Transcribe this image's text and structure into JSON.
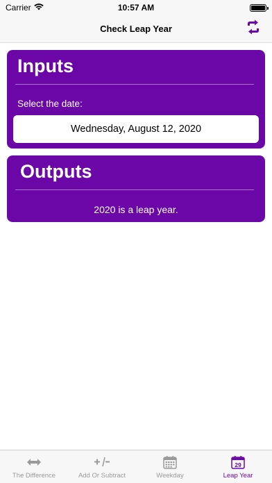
{
  "status": {
    "carrier": "Carrier",
    "time": "10:57 AM"
  },
  "nav": {
    "title": "Check Leap Year",
    "action_icon": "swap-arrows-icon"
  },
  "inputs": {
    "title": "Inputs",
    "label": "Select the date:",
    "date_value": "Wednesday, August 12, 2020"
  },
  "outputs": {
    "title": "Outputs",
    "result": "2020 is a leap year."
  },
  "tabs": [
    {
      "label": "The Difference",
      "icon": "double-arrow-icon",
      "active": false
    },
    {
      "label": "Add Or Subtract",
      "icon": "plus-minus-icon",
      "active": false
    },
    {
      "label": "Weekday",
      "icon": "calendar-grid-icon",
      "active": false
    },
    {
      "label": "Leap Year",
      "icon": "calendar-29-icon",
      "active": true
    }
  ],
  "colors": {
    "accent": "#6b07a7",
    "inactive_tab": "#9a9a9a",
    "background": "#ffffff"
  }
}
